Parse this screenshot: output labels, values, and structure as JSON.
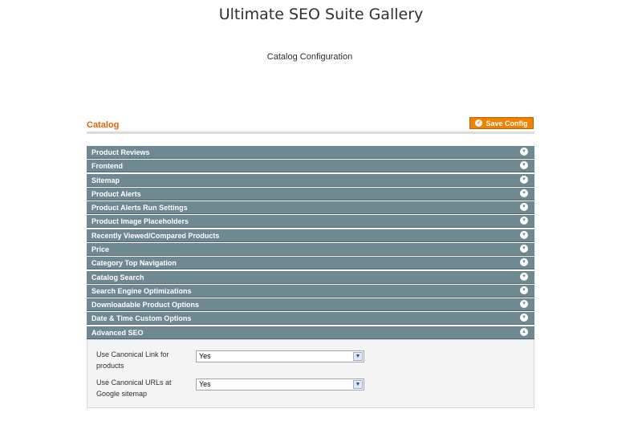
{
  "page": {
    "title": "Ultimate SEO Suite Gallery",
    "subtitle": "Catalog Configuration"
  },
  "section": {
    "title": "Catalog",
    "save_label": "Save Config"
  },
  "groups": [
    {
      "label": "Product Reviews",
      "state": "collapsed"
    },
    {
      "label": "Frontend",
      "state": "collapsed"
    },
    {
      "label": "Sitemap",
      "state": "collapsed"
    },
    {
      "label": "Product Alerts",
      "state": "collapsed"
    },
    {
      "label": "Product Alerts Run Settings",
      "state": "collapsed"
    },
    {
      "label": "Product Image Placeholders",
      "state": "collapsed"
    },
    {
      "label": "Recently Viewed/Compared Products",
      "state": "collapsed"
    },
    {
      "label": "Price",
      "state": "collapsed"
    },
    {
      "label": "Category Top Navigation",
      "state": "collapsed"
    },
    {
      "label": "Catalog Search",
      "state": "collapsed"
    },
    {
      "label": "Search Engine Optimizations",
      "state": "collapsed"
    },
    {
      "label": "Downloadable Product Options",
      "state": "collapsed"
    },
    {
      "label": "Date & Time Custom Options",
      "state": "collapsed"
    },
    {
      "label": "Advanced SEO",
      "state": "expanded"
    }
  ],
  "advanced_seo": {
    "fields": [
      {
        "label": "Use Canonical Link for products",
        "value": "Yes"
      },
      {
        "label": "Use Canonical URLs at Google sitemap",
        "value": "Yes"
      }
    ]
  },
  "colors": {
    "accent": "#eb5e00",
    "button": "#f18200",
    "group_header": "#6f8992"
  },
  "icons": {
    "save": "check-circle-icon",
    "collapsed": "chevron-down-circle-icon",
    "expanded": "chevron-up-circle-icon",
    "select": "dropdown-arrow-icon"
  }
}
